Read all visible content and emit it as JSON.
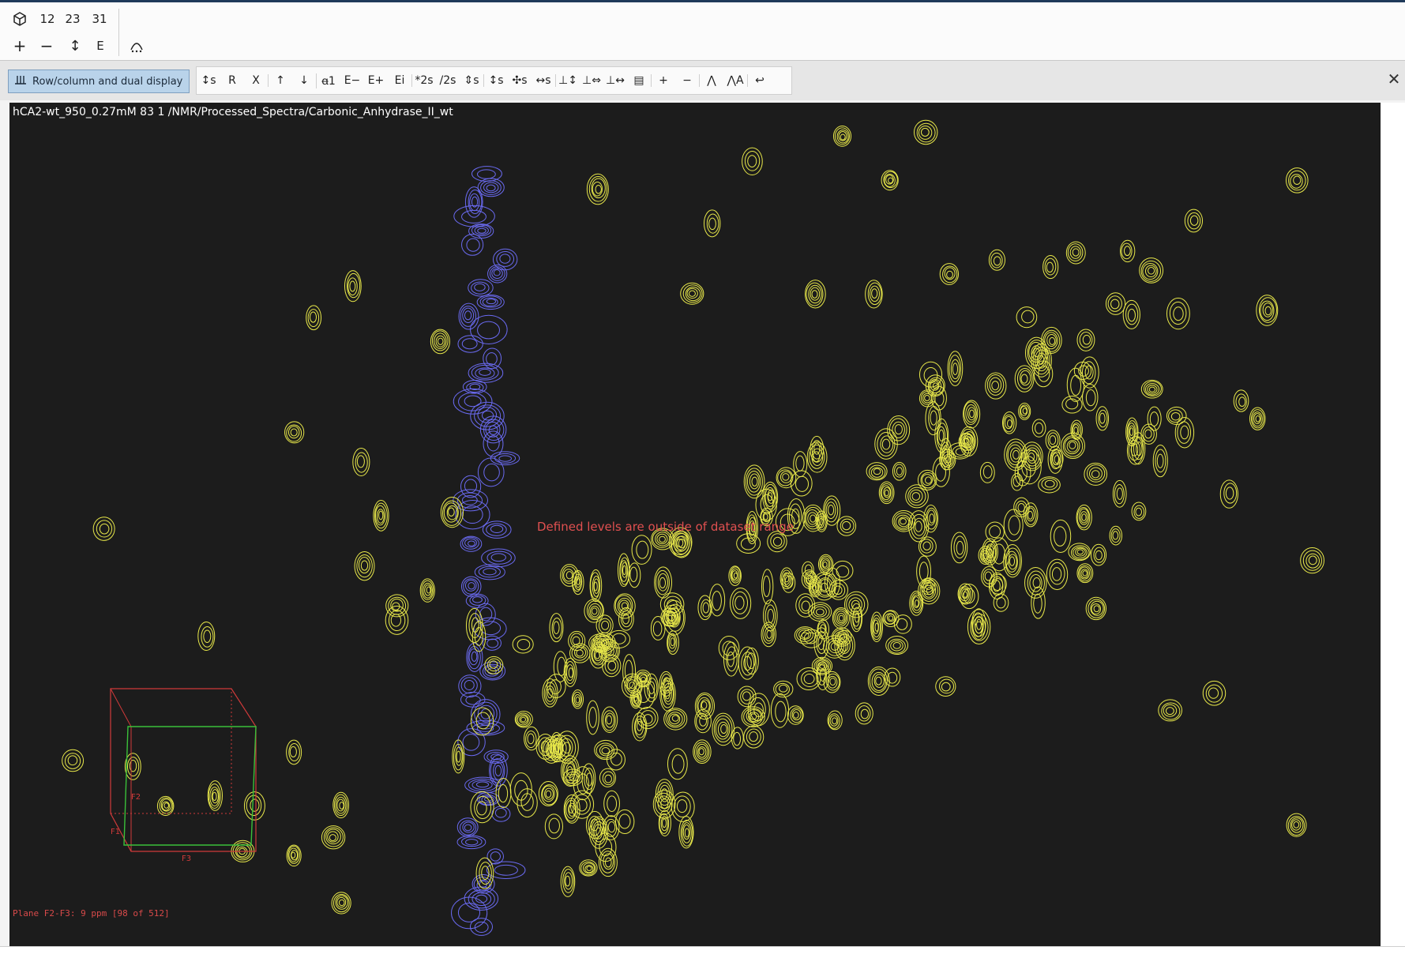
{
  "topbar": {
    "cube_icon": "cube-icon",
    "dims": [
      "12",
      "23",
      "31"
    ],
    "row2": [
      "+",
      "−",
      "↕",
      "E"
    ]
  },
  "toolbar": {
    "row_column_label": "Row/column and dual display",
    "icons": [
      "↕s",
      "R",
      "X",
      "↑",
      "↓",
      "ꬰ1",
      "E−",
      "E+",
      "Ei",
      "*2s",
      "/2s",
      "⇕s",
      "↕s",
      "✣s",
      "↔s",
      "⊥↕",
      "⊥⇔",
      "⊥↔",
      "▤",
      "+",
      "−",
      "⋀",
      "⋀A",
      "↩"
    ]
  },
  "viewer": {
    "info": "hCA2-wt_950_0.27mM  83  1  /NMR/Processed_Spectra/Carbonic_Anhydrase_II_wt",
    "warning": "Defined levels are outside of dataset range",
    "plane": "Plane  F2-F3:  9 ppm [98 of 512]",
    "cube_labels": [
      "F1",
      "F2",
      "F3"
    ]
  },
  "colors": {
    "canvas_bg": "#1c1c1c",
    "contour_positive": "#e8e84a",
    "contour_negative": "#6a6af0",
    "cube_red": "#d03a3a",
    "cube_green": "#3ac03a",
    "warning": "#e05050"
  }
}
